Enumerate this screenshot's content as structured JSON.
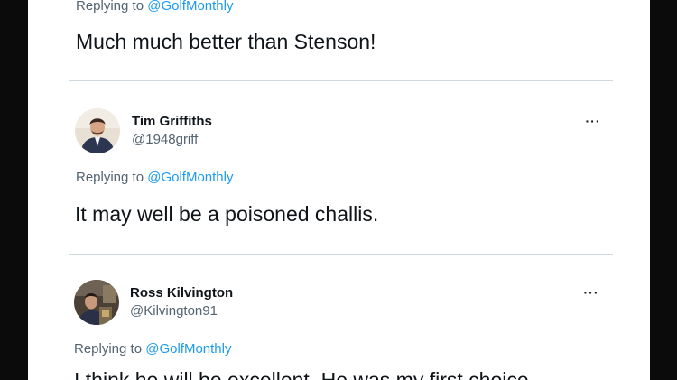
{
  "tweets": [
    {
      "replying_prefix": "Replying to",
      "replying_handle": "@GolfMonthly",
      "text": "Much much better than Stenson!"
    },
    {
      "name": "Tim Griffiths",
      "handle": "@1948griff",
      "more_icon": "more-options-icon",
      "more_glyph": "···",
      "replying_prefix": "Replying to",
      "replying_handle": "@GolfMonthly",
      "text": "It may well be a poisoned challis."
    },
    {
      "name": "Ross Kilvington",
      "handle": "@Kilvington91",
      "more_icon": "more-options-icon",
      "more_glyph": "···",
      "replying_prefix": "Replying to",
      "replying_handle": "@GolfMonthly",
      "text": "I think he will be excellent. He was my first choice"
    }
  ],
  "colors": {
    "background": "#0b0b0b",
    "card": "#ffffff",
    "link": "#1d9bf0",
    "secondary_text": "#536471"
  }
}
